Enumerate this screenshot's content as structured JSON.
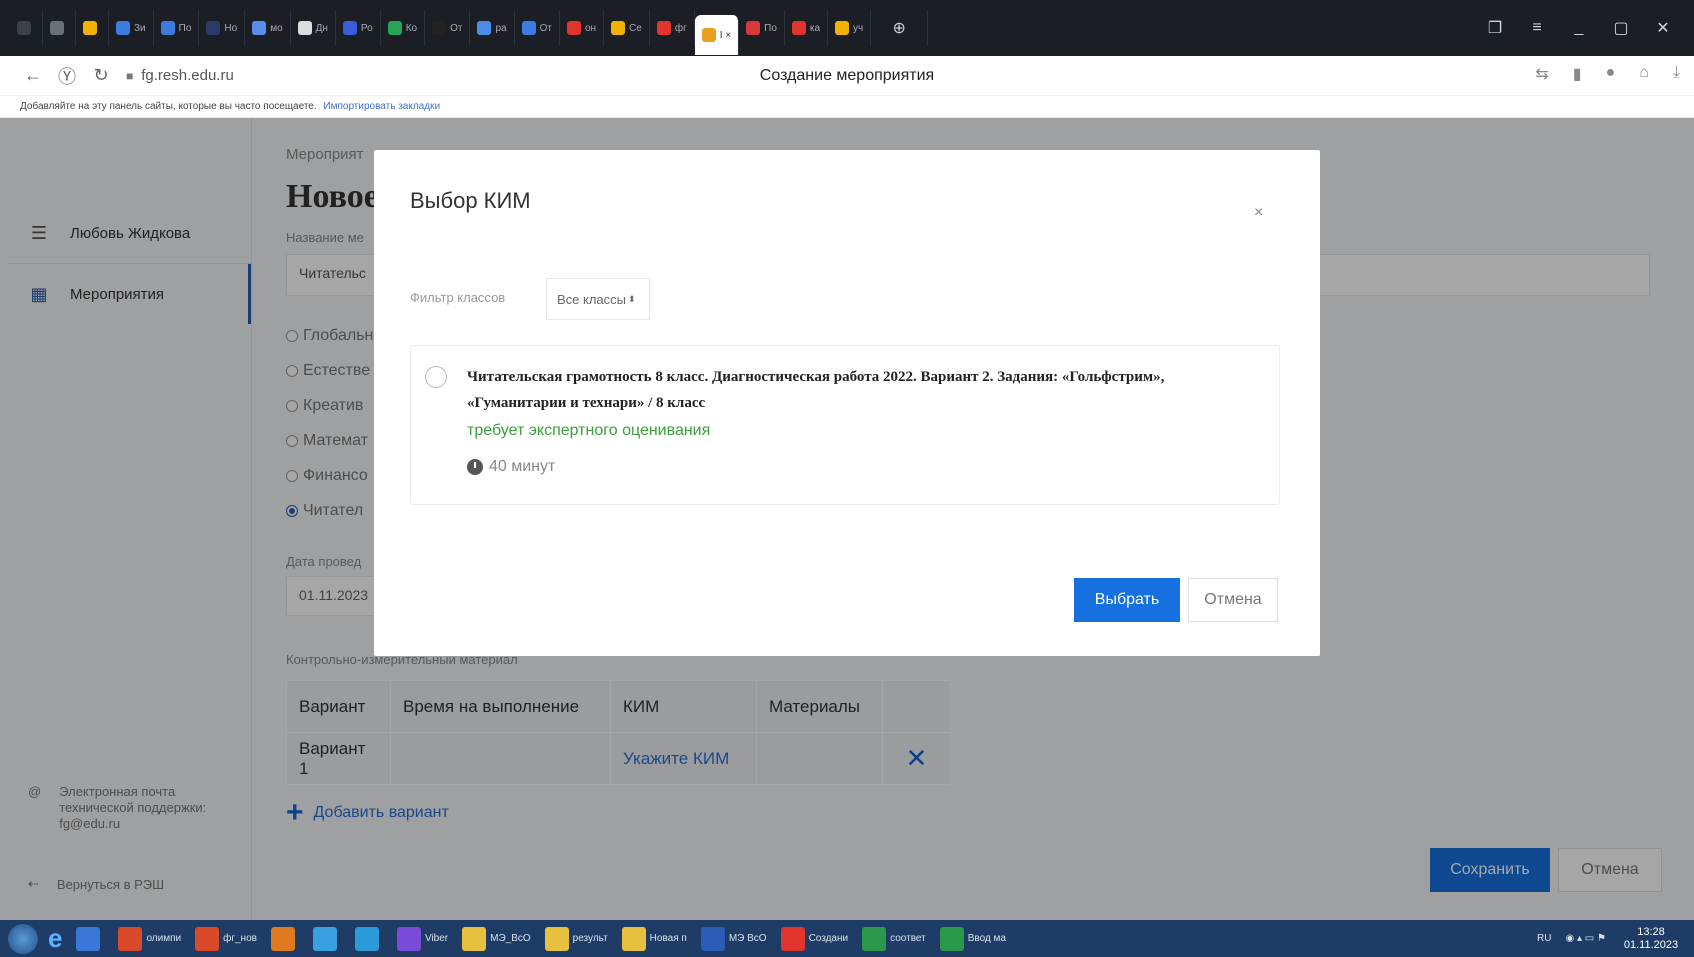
{
  "browser": {
    "tabs": [
      {
        "label": "",
        "color": "#3a3f48"
      },
      {
        "label": "",
        "color": "#6b6f78"
      },
      {
        "label": "",
        "color": "#f0b400"
      },
      {
        "label": "Зи",
        "color": "#3d7be0"
      },
      {
        "label": "По",
        "color": "#3d7be0"
      },
      {
        "label": "Но",
        "color": "#2b3a67"
      },
      {
        "label": "мо",
        "color": "#5b8ee8"
      },
      {
        "label": "Дн",
        "color": "#dddddd"
      },
      {
        "label": "Ро",
        "color": "#3b5bd8"
      },
      {
        "label": "Ко",
        "color": "#27a55a"
      },
      {
        "label": "От",
        "color": "#222222"
      },
      {
        "label": "ра",
        "color": "#4a8be8"
      },
      {
        "label": "От",
        "color": "#3d7be0"
      },
      {
        "label": "он",
        "color": "#e0342d"
      },
      {
        "label": "Се",
        "color": "#f0b400"
      },
      {
        "label": "фг",
        "color": "#e0342d"
      }
    ],
    "active_tab": {
      "label": "I ×",
      "color": "#e8a020"
    },
    "tabs_after": [
      {
        "label": "По",
        "color": "#d83a3a"
      },
      {
        "label": "ка",
        "color": "#e0342d"
      },
      {
        "label": "уч",
        "color": "#f0b400"
      }
    ],
    "url": "fg.resh.edu.ru",
    "page_title": "Создание мероприятия",
    "bookmarks_text": "Добавляйте на эту панель сайты, которые вы часто посещаете.",
    "bookmarks_link": "Импортировать закладки"
  },
  "sidebar": {
    "user_name": "Любовь Жидкова",
    "events_label": "Мероприятия",
    "support_text": "Электронная почта технической поддержки: fg@edu.ru",
    "back_label": "Вернуться в РЭШ"
  },
  "main": {
    "breadcrumb": "Мероприят",
    "title": "Новое",
    "name_label": "Название ме",
    "name_value": "Читательс",
    "radios": [
      {
        "label": "Глобальн",
        "checked": false
      },
      {
        "label": "Естестве",
        "checked": false
      },
      {
        "label": "Креатив",
        "checked": false
      },
      {
        "label": "Математ",
        "checked": false
      },
      {
        "label": "Финансо",
        "checked": false
      },
      {
        "label": "Читател",
        "checked": true
      }
    ],
    "date_label": "Дата провед",
    "date_value": "01.11.2023",
    "kim_label": "Контрольно-измерительный материал",
    "table": {
      "headers": [
        "Вариант",
        "Время на выполнение",
        "КИМ",
        "Материалы",
        ""
      ],
      "rows": [
        {
          "variant": "Вариант 1",
          "time": "",
          "kim": "Укажите КИМ",
          "materials": "",
          "delete": "✕"
        }
      ]
    },
    "add_variant": "Добавить вариант",
    "save_label": "Сохранить",
    "cancel_label": "Отмена"
  },
  "modal": {
    "title": "Выбор КИМ",
    "close": "×",
    "filter_label": "Фильтр классов",
    "filter_value": "Все классы",
    "card": {
      "title": "Читательская грамотность 8 класс. Диагностическая работа 2022. Вариант 2. Задания: «Гольфстрим», «Гуманитарии и технари» / 8 класс",
      "status": "требует экспертного оценивания",
      "time": "40 минут"
    },
    "select_label": "Выбрать",
    "cancel_label": "Отмена"
  },
  "taskbar": {
    "items": [
      {
        "label": "",
        "color": "#3a78d8"
      },
      {
        "label": "олимпи",
        "color": "#d84a2a"
      },
      {
        "label": "фг_нов",
        "color": "#d84a2a"
      },
      {
        "label": "",
        "color": "#e07a20"
      },
      {
        "label": "",
        "color": "#3aa0e0"
      },
      {
        "label": "",
        "color": "#2a9ad8"
      },
      {
        "label": "Viber",
        "color": "#7a4ad8"
      },
      {
        "label": "МЭ_ВсО",
        "color": "#e8c040"
      },
      {
        "label": "результ",
        "color": "#e8c040"
      },
      {
        "label": "Новая п",
        "color": "#e8c040"
      },
      {
        "label": "МЭ ВсО",
        "color": "#2a5cb8"
      },
      {
        "label": "Создани",
        "color": "#e0342d"
      },
      {
        "label": "соответ",
        "color": "#2a9a4a"
      },
      {
        "label": "Ввод ма",
        "color": "#2a9a4a"
      }
    ],
    "lang": "RU",
    "time": "13:28",
    "date": "01.11.2023"
  }
}
